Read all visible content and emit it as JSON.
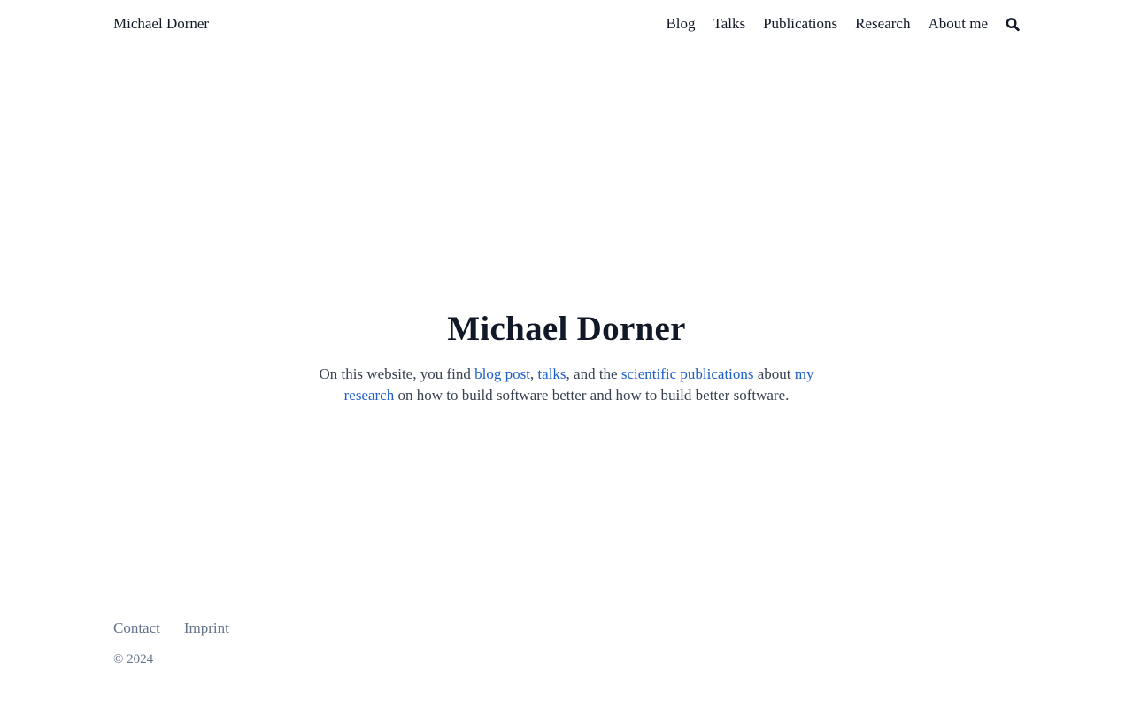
{
  "header": {
    "site_name": "Michael Dorner",
    "nav": [
      {
        "label": "Blog"
      },
      {
        "label": "Talks"
      },
      {
        "label": "Publications"
      },
      {
        "label": "Research"
      },
      {
        "label": "About me"
      }
    ],
    "search_icon": "search-icon"
  },
  "hero": {
    "title": "Michael Dorner",
    "text": {
      "part1": "On this website, you find ",
      "link_blog": "blog post",
      "part2": ", ",
      "link_talks": "talks",
      "part3": ", and the ",
      "link_publications": "scientific publications",
      "part4": " about ",
      "link_research": "my research",
      "part5": " on how to build software better and how to build better software."
    }
  },
  "footer": {
    "links": [
      {
        "label": "Contact"
      },
      {
        "label": "Imprint"
      }
    ],
    "copyright": "© 2024"
  },
  "colors": {
    "link": "#1d5fc9",
    "text": "#374151",
    "heading": "#111827",
    "muted": "#64748b"
  }
}
